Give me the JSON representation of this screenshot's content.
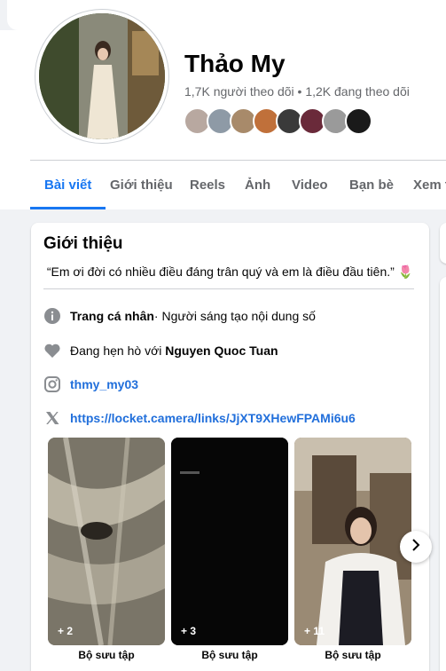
{
  "profile": {
    "name": "Thảo My",
    "followers": "1,7K người theo dõi • 1,2K đang theo dõi"
  },
  "tabs": [
    "Bài viết",
    "Giới thiệu",
    "Reels",
    "Ảnh",
    "Video",
    "Bạn bè",
    "Xem th"
  ],
  "intro": {
    "title": "Giới thiệu",
    "bio": "“Em ơi đời có nhiều điều đáng trân quý và em là điều đầu tiên.” 🌷",
    "profile_type_label": "Trang cá nhân",
    "profile_type_value": " · Người sáng tạo nội dung số",
    "relationship_prefix": "Đang hẹn hò với ",
    "relationship_name": "Nguyen Quoc Tuan",
    "instagram": "thmy_my03",
    "link": "https://locket.camera/links/JjXT9XHewFPAMi6u6"
  },
  "collections": [
    {
      "count": "+ 2",
      "label": "Bộ sưu tập"
    },
    {
      "count": "+ 3",
      "label": "Bộ sưu tập"
    },
    {
      "count": "+ 11",
      "label": "Bộ sưu tập"
    }
  ],
  "colors": {
    "accent": "#1877f2",
    "link": "#216fdb",
    "secondary_text": "#65676b",
    "background": "#f0f2f5"
  },
  "icons": [
    "info-icon",
    "heart-icon",
    "instagram-icon",
    "x-icon",
    "chevron-right-icon"
  ]
}
